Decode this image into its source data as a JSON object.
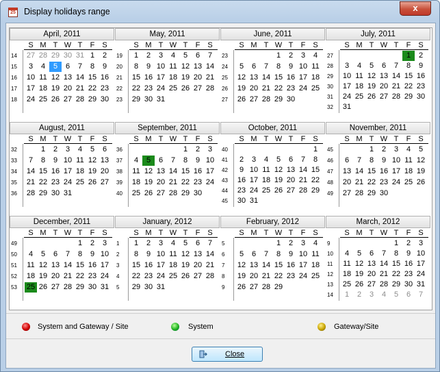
{
  "window": {
    "title": "Display holidays range",
    "close_glyph": "x",
    "app_icon": "calendar-icon"
  },
  "nav": {
    "prev": "◀",
    "next": "▶"
  },
  "dow": [
    "S",
    "M",
    "T",
    "W",
    "T",
    "F",
    "S"
  ],
  "months": [
    {
      "title": "April, 2011",
      "weeks": [
        "14",
        "15",
        "16",
        "17",
        "18"
      ],
      "rows": [
        [
          "27",
          "28",
          "29",
          "30",
          "31",
          "1",
          "2"
        ],
        [
          "3",
          "4",
          "5",
          "6",
          "7",
          "8",
          "9"
        ],
        [
          "10",
          "11",
          "12",
          "13",
          "14",
          "15",
          "16"
        ],
        [
          "17",
          "18",
          "19",
          "20",
          "21",
          "22",
          "23"
        ],
        [
          "24",
          "25",
          "26",
          "27",
          "28",
          "29",
          "30"
        ]
      ],
      "other": [
        [
          0,
          0
        ],
        [
          0,
          1
        ],
        [
          0,
          2
        ],
        [
          0,
          3
        ],
        [
          0,
          4
        ]
      ],
      "today": [
        [
          1,
          2
        ]
      ]
    },
    {
      "title": "May, 2011",
      "weeks": [
        "19",
        "20",
        "21",
        "22",
        "23"
      ],
      "rows": [
        [
          "1",
          "2",
          "3",
          "4",
          "5",
          "6",
          "7"
        ],
        [
          "8",
          "9",
          "10",
          "11",
          "12",
          "13",
          "14"
        ],
        [
          "15",
          "16",
          "17",
          "18",
          "19",
          "20",
          "21"
        ],
        [
          "22",
          "23",
          "24",
          "25",
          "26",
          "27",
          "28"
        ],
        [
          "29",
          "30",
          "31",
          "",
          "",
          "",
          ""
        ]
      ]
    },
    {
      "title": "June, 2011",
      "weeks": [
        "23",
        "24",
        "25",
        "26",
        "27"
      ],
      "rows": [
        [
          "",
          "",
          "",
          "1",
          "2",
          "3",
          "4"
        ],
        [
          "5",
          "6",
          "7",
          "8",
          "9",
          "10",
          "11"
        ],
        [
          "12",
          "13",
          "14",
          "15",
          "16",
          "17",
          "18"
        ],
        [
          "19",
          "20",
          "21",
          "22",
          "23",
          "24",
          "25"
        ],
        [
          "26",
          "27",
          "28",
          "29",
          "30",
          "",
          ""
        ]
      ]
    },
    {
      "title": "July, 2011",
      "weeks": [
        "27",
        "28",
        "29",
        "30",
        "31",
        "32"
      ],
      "rows": [
        [
          "",
          "",
          "",
          "",
          "",
          "1",
          "2"
        ],
        [
          "3",
          "4",
          "5",
          "6",
          "7",
          "8",
          "9"
        ],
        [
          "10",
          "11",
          "12",
          "13",
          "14",
          "15",
          "16"
        ],
        [
          "17",
          "18",
          "19",
          "20",
          "21",
          "22",
          "23"
        ],
        [
          "24",
          "25",
          "26",
          "27",
          "28",
          "29",
          "30"
        ],
        [
          "31",
          "",
          "",
          "",
          "",
          "",
          ""
        ]
      ],
      "green": [
        [
          0,
          5
        ]
      ]
    },
    {
      "title": "August, 2011",
      "weeks": [
        "32",
        "33",
        "34",
        "35",
        "36"
      ],
      "rows": [
        [
          "",
          "1",
          "2",
          "3",
          "4",
          "5",
          "6"
        ],
        [
          "7",
          "8",
          "9",
          "10",
          "11",
          "12",
          "13"
        ],
        [
          "14",
          "15",
          "16",
          "17",
          "18",
          "19",
          "20"
        ],
        [
          "21",
          "22",
          "23",
          "24",
          "25",
          "26",
          "27"
        ],
        [
          "28",
          "29",
          "30",
          "31",
          "",
          "",
          ""
        ]
      ]
    },
    {
      "title": "September, 2011",
      "weeks": [
        "36",
        "37",
        "38",
        "39",
        "40"
      ],
      "rows": [
        [
          "",
          "",
          "",
          "",
          "1",
          "2",
          "3"
        ],
        [
          "4",
          "5",
          "6",
          "7",
          "8",
          "9",
          "10"
        ],
        [
          "11",
          "12",
          "13",
          "14",
          "15",
          "16",
          "17"
        ],
        [
          "18",
          "19",
          "20",
          "21",
          "22",
          "23",
          "24"
        ],
        [
          "25",
          "26",
          "27",
          "28",
          "29",
          "30",
          ""
        ]
      ],
      "green": [
        [
          1,
          1
        ]
      ]
    },
    {
      "title": "October, 2011",
      "weeks": [
        "40",
        "41",
        "42",
        "43",
        "44",
        "45"
      ],
      "rows": [
        [
          "",
          "",
          "",
          "",
          "",
          "",
          "1"
        ],
        [
          "2",
          "3",
          "4",
          "5",
          "6",
          "7",
          "8"
        ],
        [
          "9",
          "10",
          "11",
          "12",
          "13",
          "14",
          "15"
        ],
        [
          "16",
          "17",
          "18",
          "19",
          "20",
          "21",
          "22"
        ],
        [
          "23",
          "24",
          "25",
          "26",
          "27",
          "28",
          "29"
        ],
        [
          "30",
          "31",
          "",
          "",
          "",
          "",
          ""
        ]
      ]
    },
    {
      "title": "November, 2011",
      "weeks": [
        "45",
        "46",
        "47",
        "48",
        "49"
      ],
      "rows": [
        [
          "",
          "",
          "1",
          "2",
          "3",
          "4",
          "5"
        ],
        [
          "6",
          "7",
          "8",
          "9",
          "10",
          "11",
          "12"
        ],
        [
          "13",
          "14",
          "15",
          "16",
          "17",
          "18",
          "19"
        ],
        [
          "20",
          "21",
          "22",
          "23",
          "24",
          "25",
          "26"
        ],
        [
          "27",
          "28",
          "29",
          "30",
          "",
          "",
          ""
        ]
      ]
    },
    {
      "title": "December, 2011",
      "weeks": [
        "49",
        "50",
        "51",
        "52",
        "53"
      ],
      "rows": [
        [
          "",
          "",
          "",
          "",
          "1",
          "2",
          "3"
        ],
        [
          "4",
          "5",
          "6",
          "7",
          "8",
          "9",
          "10"
        ],
        [
          "11",
          "12",
          "13",
          "14",
          "15",
          "16",
          "17"
        ],
        [
          "18",
          "19",
          "20",
          "21",
          "22",
          "23",
          "24"
        ],
        [
          "25",
          "26",
          "27",
          "28",
          "29",
          "30",
          "31"
        ]
      ],
      "green": [
        [
          4,
          0
        ]
      ]
    },
    {
      "title": "January, 2012",
      "weeks": [
        "1",
        "2",
        "3",
        "4",
        "5"
      ],
      "rows": [
        [
          "1",
          "2",
          "3",
          "4",
          "5",
          "6",
          "7"
        ],
        [
          "8",
          "9",
          "10",
          "11",
          "12",
          "13",
          "14"
        ],
        [
          "15",
          "16",
          "17",
          "18",
          "19",
          "20",
          "21"
        ],
        [
          "22",
          "23",
          "24",
          "25",
          "26",
          "27",
          "28"
        ],
        [
          "29",
          "30",
          "31",
          "",
          "",
          "",
          ""
        ]
      ]
    },
    {
      "title": "February, 2012",
      "weeks": [
        "5",
        "6",
        "7",
        "8",
        "9"
      ],
      "rows": [
        [
          "",
          "",
          "",
          "1",
          "2",
          "3",
          "4"
        ],
        [
          "5",
          "6",
          "7",
          "8",
          "9",
          "10",
          "11"
        ],
        [
          "12",
          "13",
          "14",
          "15",
          "16",
          "17",
          "18"
        ],
        [
          "19",
          "20",
          "21",
          "22",
          "23",
          "24",
          "25"
        ],
        [
          "26",
          "27",
          "28",
          "29",
          "",
          "",
          ""
        ]
      ]
    },
    {
      "title": "March, 2012",
      "weeks": [
        "9",
        "10",
        "11",
        "12",
        "13",
        "14"
      ],
      "rows": [
        [
          "",
          "",
          "",
          "",
          "1",
          "2",
          "3"
        ],
        [
          "4",
          "5",
          "6",
          "7",
          "8",
          "9",
          "10"
        ],
        [
          "11",
          "12",
          "13",
          "14",
          "15",
          "16",
          "17"
        ],
        [
          "18",
          "19",
          "20",
          "21",
          "22",
          "23",
          "24"
        ],
        [
          "25",
          "26",
          "27",
          "28",
          "29",
          "30",
          "31"
        ],
        [
          "1",
          "2",
          "3",
          "4",
          "5",
          "6",
          "7"
        ]
      ],
      "other": [
        [
          5,
          0
        ],
        [
          5,
          1
        ],
        [
          5,
          2
        ],
        [
          5,
          3
        ],
        [
          5,
          4
        ],
        [
          5,
          5
        ],
        [
          5,
          6
        ]
      ]
    }
  ],
  "legend": [
    {
      "label": "System and Gateway / Site",
      "color": "red"
    },
    {
      "label": "System",
      "color": "green"
    },
    {
      "label": "Gateway/Site",
      "color": "yellow"
    }
  ],
  "close_button": {
    "label": "Close",
    "icon": "exit-door-icon"
  },
  "colors": {
    "today": "#2f9bff",
    "holiday": "#1a8a1a"
  }
}
